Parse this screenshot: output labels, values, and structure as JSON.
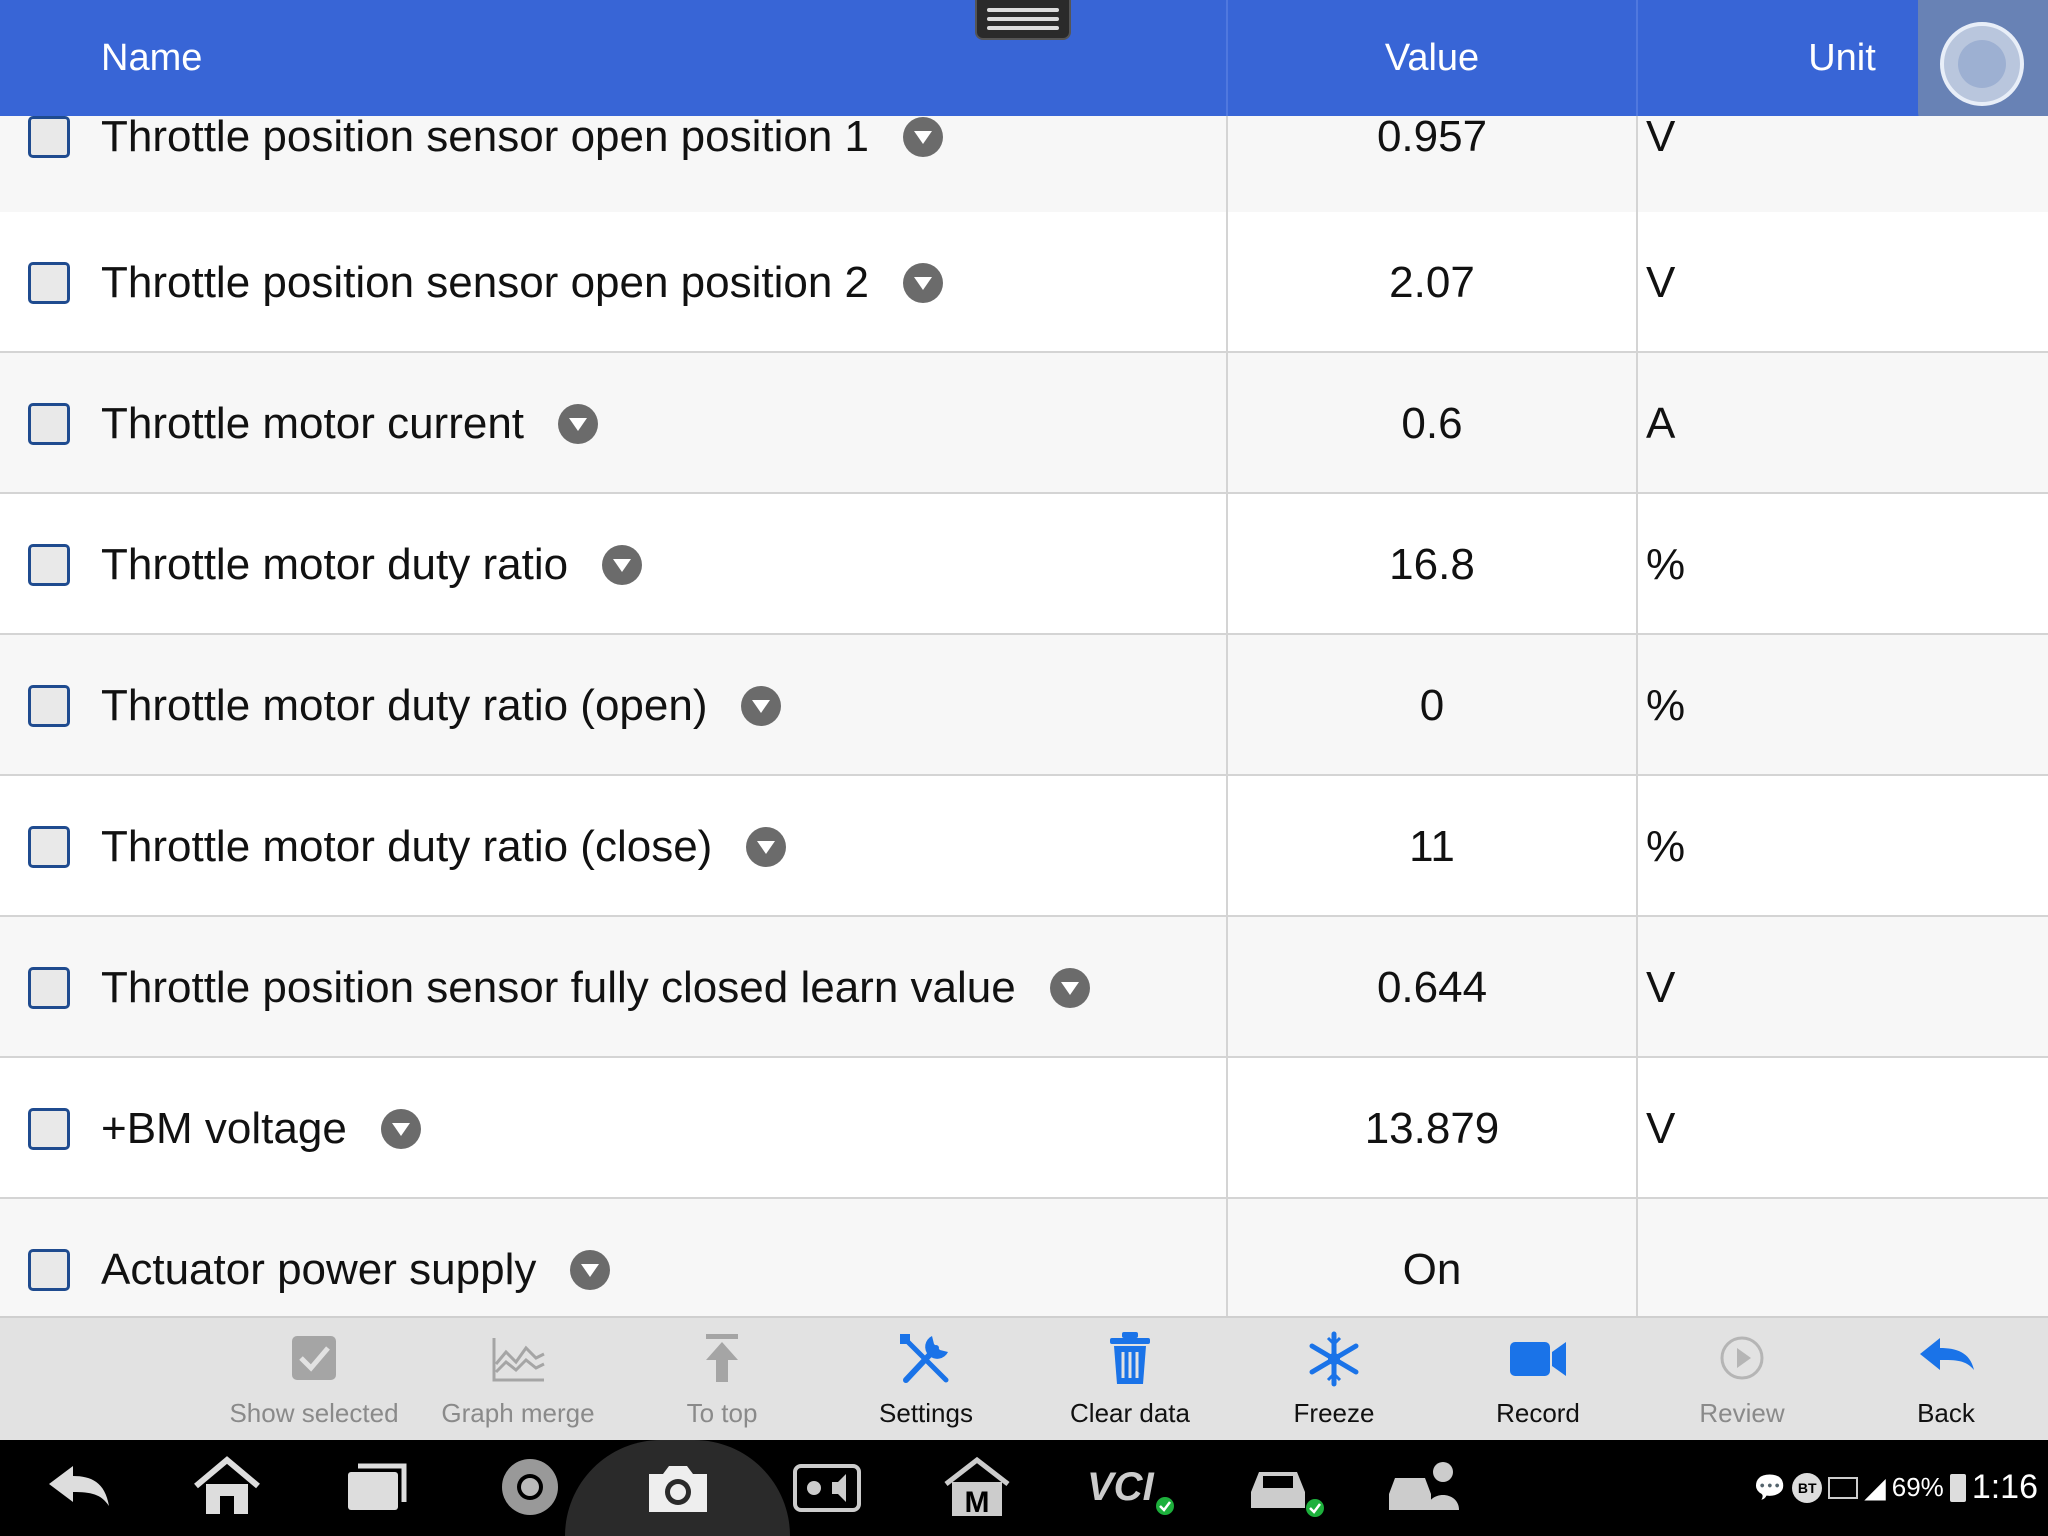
{
  "header": {
    "name": "Name",
    "value": "Value",
    "unit": "Unit"
  },
  "rows": [
    {
      "name": "Throttle position sensor open position 1",
      "value": "0.957",
      "unit": "V"
    },
    {
      "name": "Throttle position sensor open position 2",
      "value": "2.07",
      "unit": "V"
    },
    {
      "name": "Throttle motor current",
      "value": "0.6",
      "unit": "A"
    },
    {
      "name": "Throttle motor duty ratio",
      "value": "16.8",
      "unit": "%"
    },
    {
      "name": "Throttle motor duty ratio (open)",
      "value": "0",
      "unit": "%"
    },
    {
      "name": "Throttle motor duty ratio (close)",
      "value": "11",
      "unit": "%"
    },
    {
      "name": "Throttle position sensor fully closed learn value",
      "value": "0.644",
      "unit": "V"
    },
    {
      "name": "+BM voltage",
      "value": "13.879",
      "unit": "V"
    },
    {
      "name": "Actuator power supply",
      "value": "On",
      "unit": ""
    }
  ],
  "toolbar": {
    "show_selected": "Show selected",
    "graph_merge": "Graph merge",
    "to_top": "To top",
    "settings": "Settings",
    "clear_data": "Clear data",
    "freeze": "Freeze",
    "record": "Record",
    "review": "Review",
    "back": "Back"
  },
  "status": {
    "battery": "69%",
    "time": "1:16",
    "bt": "BT"
  },
  "colors": {
    "header": "#3865d6",
    "accent": "#1a73e8",
    "toolbar": "#e2e2e2"
  }
}
